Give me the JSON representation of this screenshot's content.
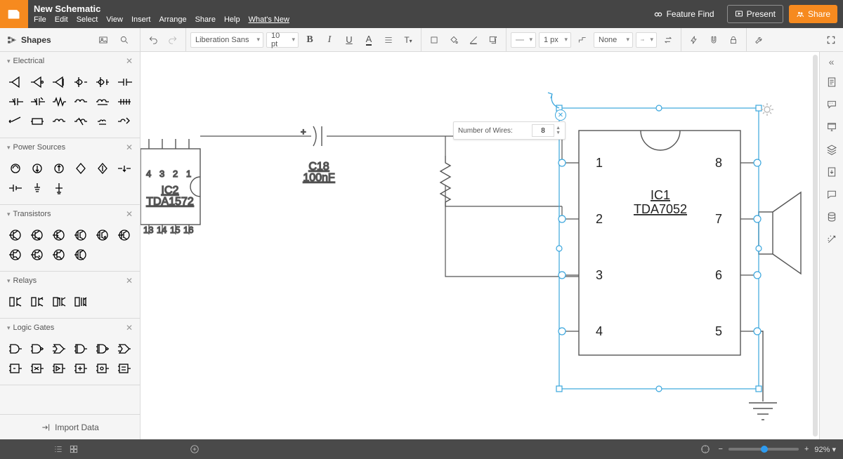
{
  "title": "New Schematic",
  "menus": [
    "File",
    "Edit",
    "Select",
    "View",
    "Insert",
    "Arrange",
    "Share",
    "Help",
    "What's New"
  ],
  "header_buttons": {
    "feature_find": "Feature Find",
    "present": "Present",
    "share": "Share"
  },
  "shapes_label": "Shapes",
  "toolbar": {
    "font": "Liberation Sans",
    "font_size": "10 pt",
    "stroke_width": "1 px",
    "fill": "None"
  },
  "libraries": [
    {
      "name": "Electrical",
      "items": 18
    },
    {
      "name": "Power Sources",
      "items": 9
    },
    {
      "name": "Transistors",
      "items": 10
    },
    {
      "name": "Relays",
      "items": 4
    },
    {
      "name": "Logic Gates",
      "items": 12
    }
  ],
  "import_label": "Import Data",
  "popover": {
    "label": "Number of Wires:",
    "value": "8"
  },
  "components": {
    "ic1": {
      "ref": "IC1",
      "part": "TDA7052",
      "pins": [
        "1",
        "2",
        "3",
        "4",
        "5",
        "6",
        "7",
        "8"
      ]
    },
    "ic2": {
      "ref": "IC2",
      "part": "TDA1572",
      "pins_top": [
        "4",
        "3",
        "2",
        "1"
      ],
      "pins_bottom": [
        "13",
        "14",
        "15",
        "16"
      ]
    },
    "cap": {
      "ref": "C18",
      "value": "100nF"
    }
  },
  "zoom": "92%"
}
